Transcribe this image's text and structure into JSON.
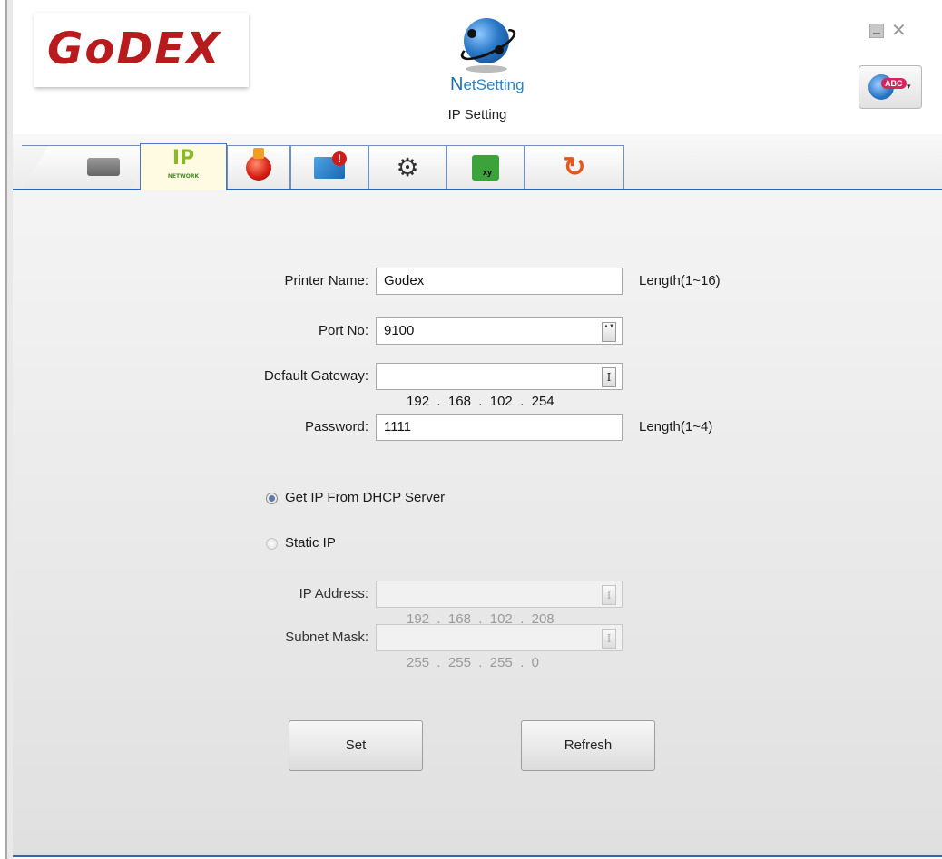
{
  "header": {
    "logo_text": "GoDEX",
    "brand_n": "N",
    "brand_rest": "etSetting",
    "subtitle": "IP Setting",
    "icons": {
      "minimize": "minimize-icon",
      "close": "close-icon",
      "language": "language-globe-icon"
    },
    "close_glyph": "✕",
    "lang_badge": "ABC",
    "lang_arrow": "▾"
  },
  "tabs": [
    {
      "name": "printer-tab",
      "icon": "printer-icon"
    },
    {
      "name": "ip-network-tab",
      "icon": "ip-network-icon",
      "label_big": "IP",
      "label_small": "NETWORK",
      "active": true
    },
    {
      "name": "alert-tab",
      "icon": "alarm-button-icon"
    },
    {
      "name": "email-tab",
      "icon": "mail-alert-icon"
    },
    {
      "name": "tools-tab",
      "icon": "tools-icon"
    },
    {
      "name": "coordinates-tab",
      "icon": "xy-icon"
    },
    {
      "name": "refresh-tab",
      "icon": "refresh-icon",
      "glyph": "↻"
    }
  ],
  "form": {
    "printer_name": {
      "label": "Printer Name:",
      "value": "Godex",
      "hint": "Length(1~16)"
    },
    "port_no": {
      "label": "Port No:",
      "value": "9100"
    },
    "default_gateway": {
      "label": "Default Gateway:",
      "value": "192  .  168  .  102  .  254"
    },
    "password": {
      "label": "Password:",
      "value": "1111",
      "hint": "Length(1~4)"
    },
    "dhcp": {
      "label": "Get IP From DHCP Server",
      "selected": true
    },
    "static": {
      "label": "Static IP",
      "selected": false
    },
    "ip_address": {
      "label": "IP Address:",
      "value": "192  .  168  .  102  .  208",
      "disabled": true
    },
    "subnet_mask": {
      "label": "Subnet Mask:",
      "value": "255  .  255  .  255  .  0",
      "disabled": true
    },
    "spin_glyph": "▲▼",
    "ibeam_glyph": "I"
  },
  "buttons": {
    "set": "Set",
    "refresh": "Refresh"
  },
  "colors": {
    "accent": "#2a66b8",
    "logo_red": "#b81b1e",
    "brand_blue": "#2a82c8"
  }
}
